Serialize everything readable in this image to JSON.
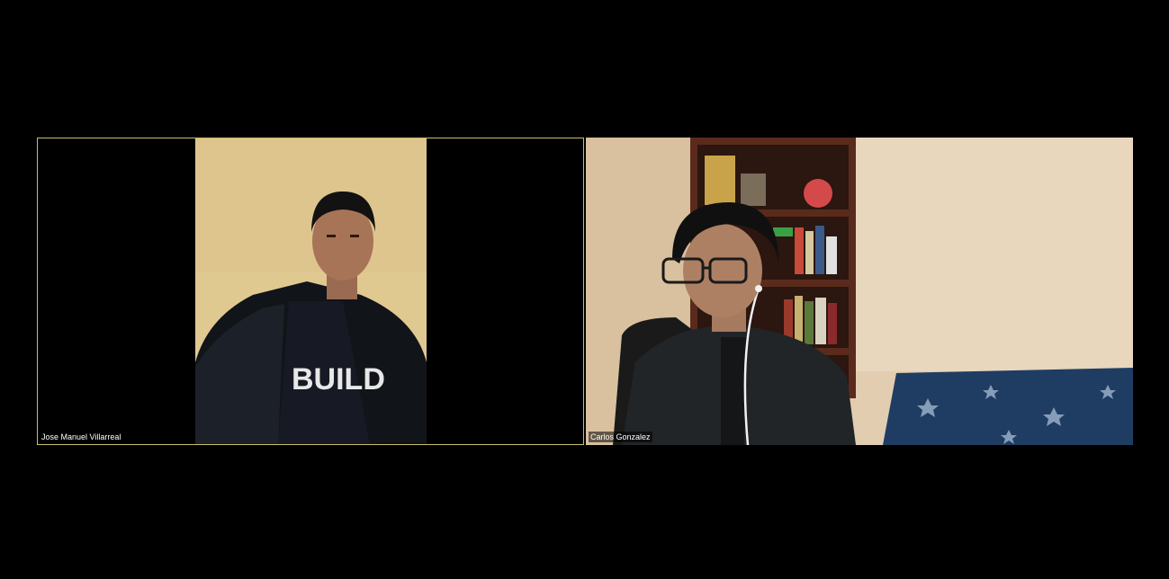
{
  "meeting": {
    "participants": [
      {
        "name": "Jose Manuel Villarreal",
        "active_speaker": true,
        "shirt_text": "BUILD"
      },
      {
        "name": "Carlos Gonzalez",
        "active_speaker": false
      }
    ]
  },
  "colors": {
    "background": "#000000",
    "active_speaker_outline": "#c9bf6a",
    "wall_left_tile": "#e0c891",
    "wall_right_tile": "#e2cdb0",
    "bedspread": "#1f3d63"
  }
}
